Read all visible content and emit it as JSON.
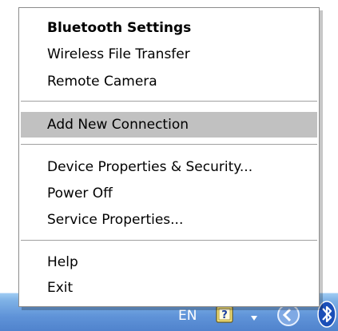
{
  "menu": {
    "items": [
      {
        "label": "Bluetooth Settings",
        "bold": true
      },
      {
        "label": "Wireless File Transfer"
      },
      {
        "label": "Remote Camera"
      },
      {
        "label": "Add New Connection",
        "highlighted": true
      },
      {
        "label": "Device Properties & Security..."
      },
      {
        "label": "Power Off"
      },
      {
        "label": "Service Properties..."
      },
      {
        "label": "Help"
      },
      {
        "label": "Exit"
      }
    ]
  },
  "taskbar": {
    "language": "EN",
    "tray_icons": [
      "help-icon",
      "down-arrow-icon",
      "collapse-tray-icon",
      "bluetooth-icon"
    ]
  },
  "colors": {
    "highlight": "#c1c1c1",
    "taskbar": "#5f93d8",
    "bluetooth": "#1b4fb8"
  }
}
